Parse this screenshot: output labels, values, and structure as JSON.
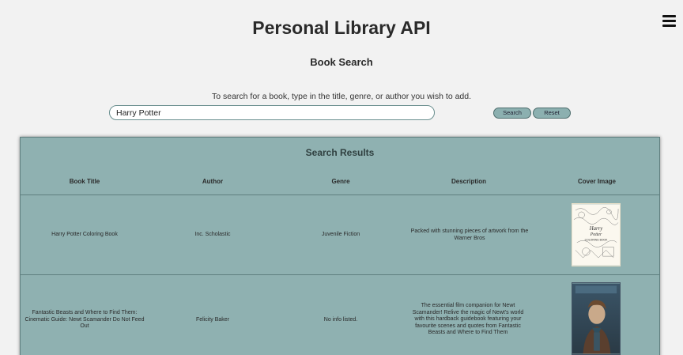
{
  "header": {
    "app_title": "Personal Library API",
    "section_title": "Book Search",
    "instructions": "To search for a book, type in the title, genre, or author you wish to add."
  },
  "search": {
    "value": "Harry Potter",
    "search_label": "Search",
    "reset_label": "Reset"
  },
  "results": {
    "title": "Search Results",
    "columns": [
      "Book Title",
      "Author",
      "Genre",
      "Description",
      "Cover Image"
    ],
    "rows": [
      {
        "title": "Harry Potter Coloring Book",
        "author": "Inc. Scholastic",
        "genre": "Juvenile Fiction",
        "description": "Packed with stunning pieces of artwork from the Warner Bros"
      },
      {
        "title": "Fantastic Beasts and Where to Find Them: Cinematic Guide: Newt Scamander Do Not Feed Out",
        "author": "Felicity Baker",
        "genre": "No info listed.",
        "description": "The essential film companion for Newt Scamander! Relive the magic of Newt's world with this hardback guidebook featuring your favourite scenes and quotes from Fantastic Beasts and Where to Find Them"
      }
    ]
  },
  "colors": {
    "background": "#f2f2f2",
    "panel": "#8fb1b1",
    "button": "#8cb0b0"
  }
}
